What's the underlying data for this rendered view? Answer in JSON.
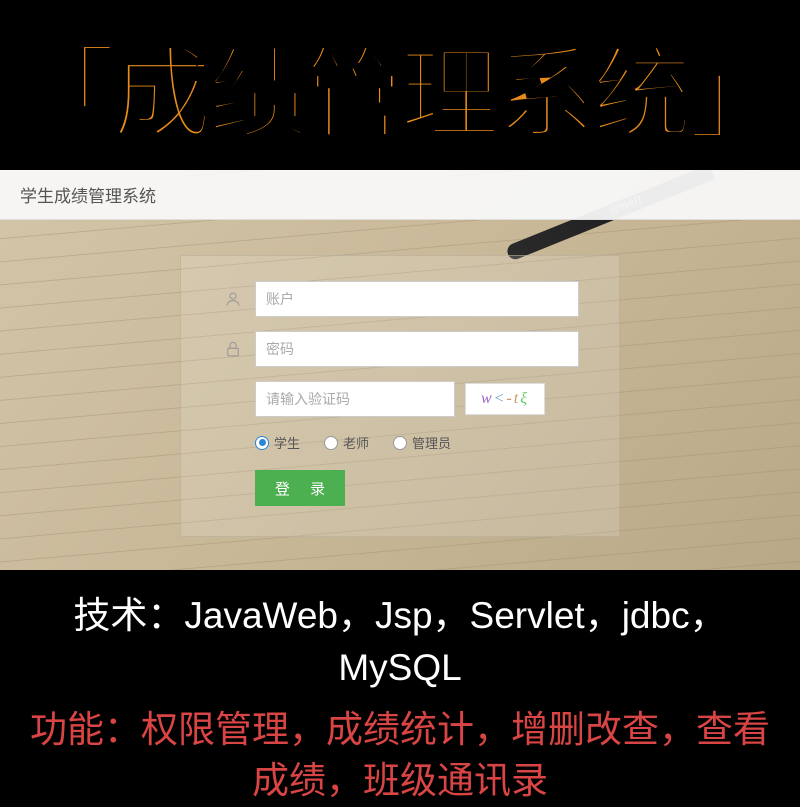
{
  "hero": {
    "title": "「成绩管理系统」"
  },
  "app": {
    "header_title": "学生成绩管理系统",
    "pencil_text": "@%#!!",
    "login": {
      "account_placeholder": "账户",
      "password_placeholder": "密码",
      "captcha_placeholder": "请输入验证码",
      "captcha_chars": [
        "w",
        "<",
        "-t",
        "ξ"
      ],
      "roles": [
        {
          "label": "学生",
          "selected": true
        },
        {
          "label": "老师",
          "selected": false
        },
        {
          "label": "管理员",
          "selected": false
        }
      ],
      "submit_label": "登 录"
    }
  },
  "footer": {
    "tech_label": "技术：JavaWeb，Jsp，Servlet，jdbc，MySQL",
    "feature_label": "功能：权限管理，成绩统计，增删改查，查看成绩，班级通讯录"
  }
}
